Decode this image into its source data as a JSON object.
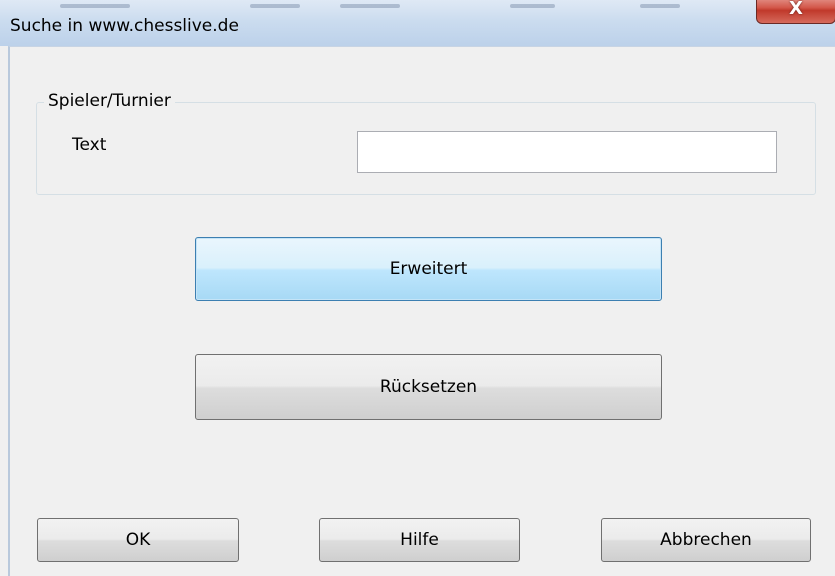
{
  "window": {
    "title": "Suche in www.chesslive.de",
    "close_glyph": "X"
  },
  "group": {
    "label": "Spieler/Turnier",
    "text_label": "Text",
    "text_value": ""
  },
  "buttons": {
    "advanced": "Erweitert",
    "reset": "Rücksetzen",
    "ok": "OK",
    "help": "Hilfe",
    "cancel": "Abbrechen"
  },
  "colors": {
    "focus_border": "#3c7fb1",
    "close_red": "#c0392b"
  }
}
